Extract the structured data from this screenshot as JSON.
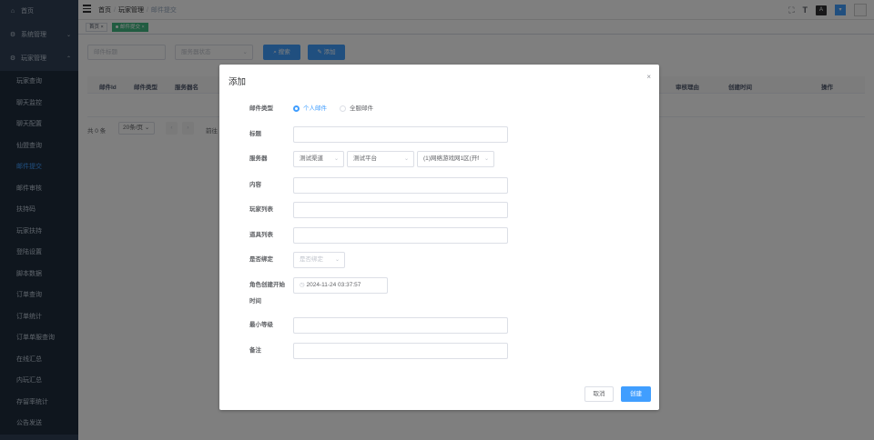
{
  "sidebar": {
    "top_items": [
      {
        "icon": "home-icon",
        "label": "首页"
      },
      {
        "icon": "system-icon",
        "label": "系统管理"
      },
      {
        "icon": "player-icon",
        "label": "玩家管理"
      }
    ],
    "sub_items": [
      "玩家查询",
      "聊天监控",
      "聊天配置",
      "仙盟查询",
      "邮件提交",
      "邮件审核",
      "扶持码",
      "玩家扶持",
      "登陆设置",
      "脚本数据",
      "订单查询",
      "订单统计",
      "订单单服查询",
      "在线汇总",
      "内玩汇总",
      "存留率统计",
      "公告发送"
    ],
    "active_index": 4
  },
  "navbar": {
    "breadcrumb": [
      "首页",
      "玩家管理",
      "邮件提交"
    ],
    "size_label": "A",
    "avatar_label": "▾"
  },
  "tags": {
    "home": "首页",
    "active": "邮件提交"
  },
  "filters": {
    "title_placeholder": "邮件标题",
    "server_placeholder": "服务器状态",
    "search_label": "搜索",
    "add_label": "添加"
  },
  "table": {
    "headers": [
      "邮件Id",
      "邮件类型",
      "服务器名",
      "审核理由",
      "创建时间",
      "操作"
    ]
  },
  "pager": {
    "total": "共 0 条",
    "size": "20条/页",
    "goto": "前往"
  },
  "dialog": {
    "title": "添加",
    "labels": {
      "mail_type": "邮件类型",
      "title": "标题",
      "server": "服务器",
      "content": "内容",
      "player_list": "玩家列表",
      "item_list": "道具列表",
      "bind": "是否绑定",
      "role_time": "角色创建开始",
      "role_time2": "时间",
      "min_level": "最小等级",
      "remark": "备注"
    },
    "mail_type_options": [
      "个人邮件",
      "全服邮件"
    ],
    "server_selects": [
      "测试渠道",
      "测试平台",
      "(1)网络游戏网1区(开f"
    ],
    "bind_placeholder": "是否绑定",
    "role_time_value": "2024-11-24 03:37:57",
    "cancel_label": "取消",
    "create_label": "创建"
  },
  "colors": {
    "primary": "#409eff",
    "sidebar_bg": "#304156",
    "tag_active": "#42b983"
  }
}
